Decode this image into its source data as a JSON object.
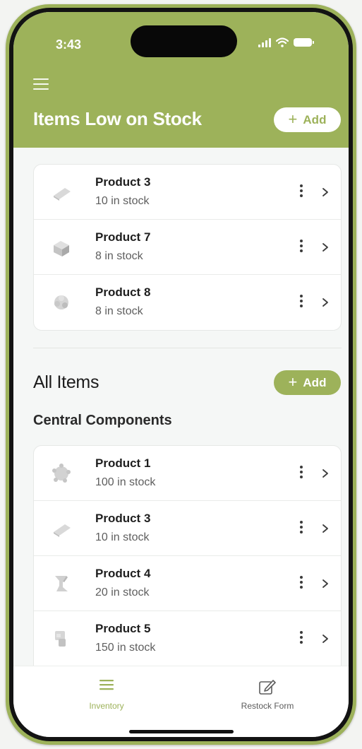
{
  "status_bar": {
    "time": "3:43"
  },
  "header": {
    "title": "Items Low on Stock",
    "add_label": "Add",
    "background": "#9db25a"
  },
  "low_stock": [
    {
      "name": "Product 3",
      "stock": "10 in stock",
      "icon": "wedge-part-icon"
    },
    {
      "name": "Product 7",
      "stock": "8 in stock",
      "icon": "block-part-icon"
    },
    {
      "name": "Product 8",
      "stock": "8 in stock",
      "icon": "gear-part-icon"
    }
  ],
  "all_items": {
    "title": "All Items",
    "add_label": "Add",
    "category": "Central Components",
    "items": [
      {
        "name": "Product 1",
        "stock": "100 in stock",
        "icon": "gear-part-icon"
      },
      {
        "name": "Product 3",
        "stock": "10 in stock",
        "icon": "wedge-part-icon"
      },
      {
        "name": "Product 4",
        "stock": "20 in stock",
        "icon": "bracket-part-icon"
      },
      {
        "name": "Product 5",
        "stock": "150 in stock",
        "icon": "connector-part-icon"
      }
    ]
  },
  "tabbar": {
    "tabs": [
      {
        "label": "Inventory",
        "icon": "list-icon",
        "active": true
      },
      {
        "label": "Restock Form",
        "icon": "edit-form-icon",
        "active": false
      }
    ]
  },
  "colors": {
    "accent": "#9db25a",
    "text": "#1e1e1e",
    "muted": "#5e5e5e"
  }
}
